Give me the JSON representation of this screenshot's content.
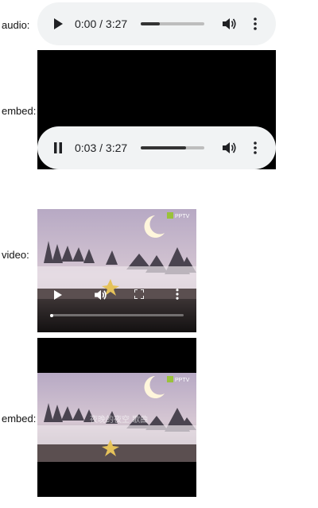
{
  "labels": {
    "audio": "audio:",
    "embed1": "embed:",
    "video": "video:",
    "embed2": "embed:"
  },
  "audio_player": {
    "state": "paused",
    "time": "0:00 / 3:27",
    "progress": 0.0,
    "buffered": 0.3
  },
  "embed_audio_player": {
    "state": "playing",
    "time": "0:03 / 3:27",
    "progress": 0.015,
    "buffered": 0.71
  },
  "video_player": {
    "state": "paused",
    "progress": 0.0
  },
  "watermark": "PPTV",
  "embed_caption": "夜晚的夜空 歌曲",
  "icons": {
    "play": "play-icon",
    "pause": "pause-icon",
    "volume": "volume-icon",
    "more": "more-vert-icon",
    "fullscreen": "fullscreen-icon"
  },
  "colors": {
    "control_bar_bg": "#f1f3f4",
    "track_bg": "#bdbdbd",
    "track_fill": "#333333"
  }
}
